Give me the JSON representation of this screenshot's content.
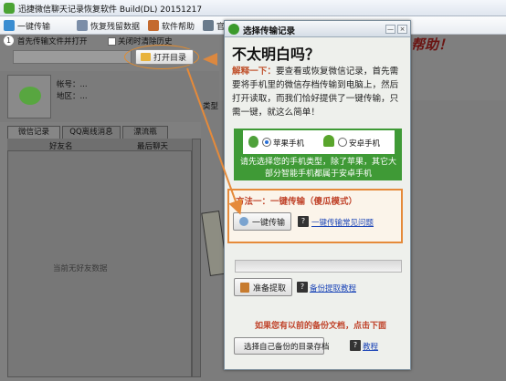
{
  "window": {
    "title": "迅捷微信聊天记录恢复软件 Build(DL) 20151217"
  },
  "toolbar": {
    "items": [
      {
        "label": "一键传输",
        "icon": "transfer-icon"
      },
      {
        "label": "恢复残留数据",
        "icon": "restore-icon"
      },
      {
        "label": "软件帮助",
        "icon": "help-icon"
      },
      {
        "label": "官",
        "icon": "official-icon"
      }
    ]
  },
  "step1": {
    "number": "1",
    "label": "首先传输文件并打开",
    "checkbox_label": "关闭时清除历史"
  },
  "path": {
    "value": "",
    "open_button": "打开目录"
  },
  "profile": {
    "account_label": "帐号：...",
    "region_label": "地区：..."
  },
  "tabs": [
    "微信记录",
    "QQ离线消息",
    "漂流瓶"
  ],
  "list": {
    "columns": [
      "好友名",
      "最后聊天"
    ],
    "empty_text": "当前无好友数据"
  },
  "right_header": "类型",
  "slogan": "帮助！",
  "dialog": {
    "title": "选择传输记录",
    "close_buttons": [
      "—",
      "×"
    ],
    "headline": "不太明白吗？",
    "explain_label": "解释一下：",
    "explain_text": "要查看或恢复微信记录，首先需要将手机里的微信存档传输到电脑上，然后打开读取，而我们恰好提供了一键传输，只需一键，就这么简单！",
    "phone_options": [
      "苹果手机",
      "安卓手机"
    ],
    "phone_hint": "请先选择您的手机类型，除了苹果，其它大部分智能手机都属于安卓手机",
    "method1_title": "方法一：一键传输（傻瓜模式）",
    "onekey_button": "一键传输",
    "onekey_faq": "一键传输常见问题",
    "prep_button": "准备提取",
    "backup_tutorial": "备份提取教程",
    "backup_title": "如果您有以前的备份文档，点击下面",
    "select_button": "选择自己备份的目录存档",
    "tutorial_link": "教程"
  },
  "colors": {
    "accent_orange": "#e58a3a",
    "green": "#3f9a36",
    "link_blue": "#1e47b8"
  }
}
